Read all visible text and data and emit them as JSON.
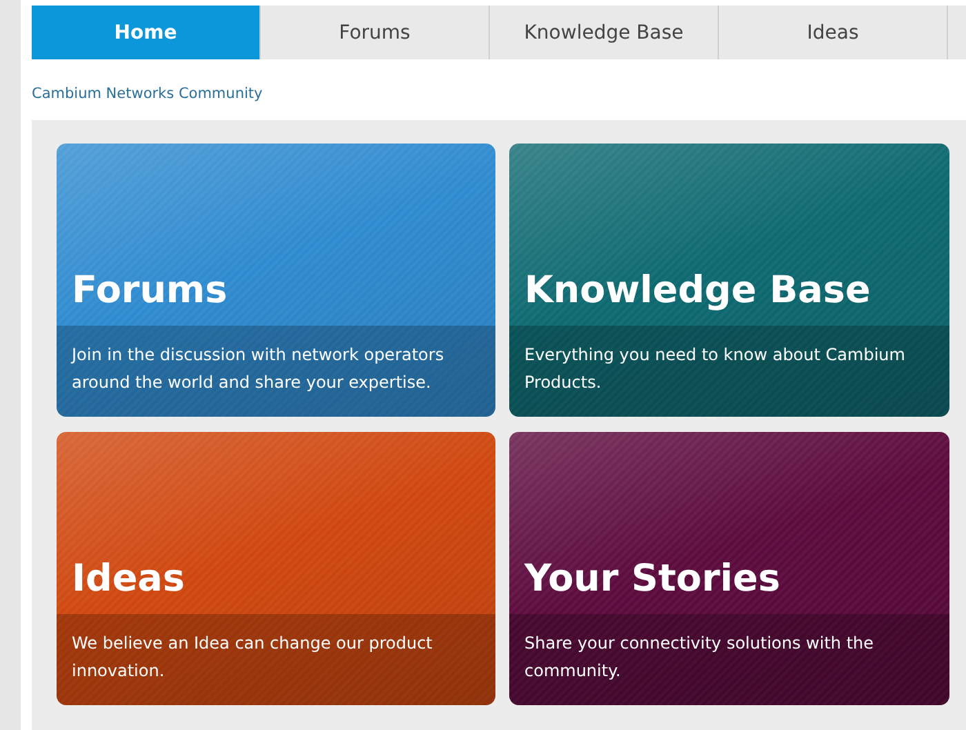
{
  "tabs": [
    {
      "label": "Home",
      "selected": true
    },
    {
      "label": "Forums",
      "selected": false
    },
    {
      "label": "Knowledge Base",
      "selected": false
    },
    {
      "label": "Ideas",
      "selected": false
    }
  ],
  "breadcrumb": "Cambium Networks Community",
  "tiles": [
    {
      "title": "Forums",
      "description": "Join in the discussion with network operators around the world and share your expertise.",
      "color": "#2f8bcf"
    },
    {
      "title": "Knowledge Base",
      "description": "Everything you need to know about Cambium Products.",
      "color": "#0e6970"
    },
    {
      "title": "Ideas",
      "description": "We believe an Idea can change our product innovation.",
      "color": "#cf470f"
    },
    {
      "title": "Your Stories",
      "description": "Share your connectivity solutions with the community.",
      "color": "#5c0b3d"
    }
  ]
}
